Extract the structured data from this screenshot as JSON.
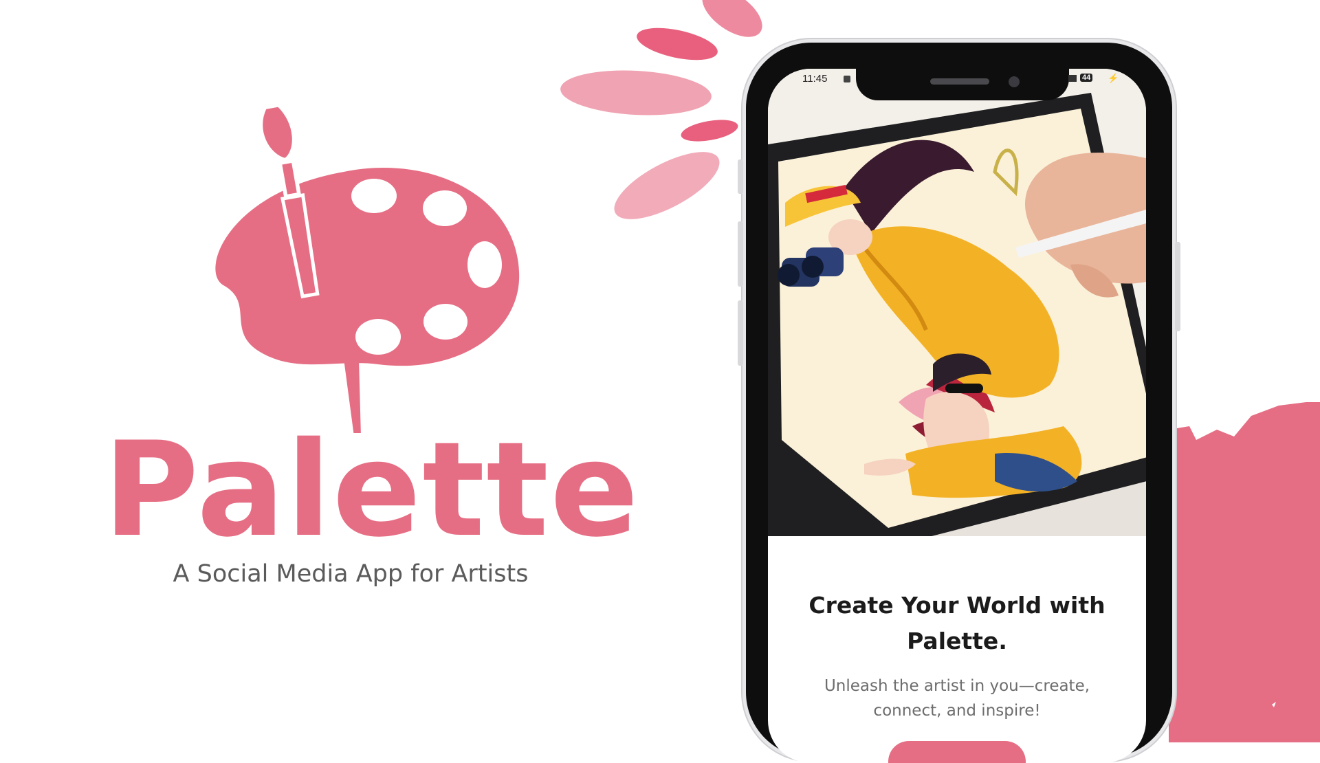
{
  "brand": {
    "name": "Palette",
    "tagline": "A Social Media App for Artists",
    "accent_color": "#e66e84",
    "logo_icon": "palette-brush-icon"
  },
  "phone": {
    "status_bar": {
      "time": "11:45",
      "battery": "44"
    },
    "screen": {
      "headline": "Create Your World with Palette.",
      "subtext": "Unleash the artist in you—create, connect, and inspire!",
      "hero_image": "digital-illustration-on-tablet-image"
    }
  }
}
